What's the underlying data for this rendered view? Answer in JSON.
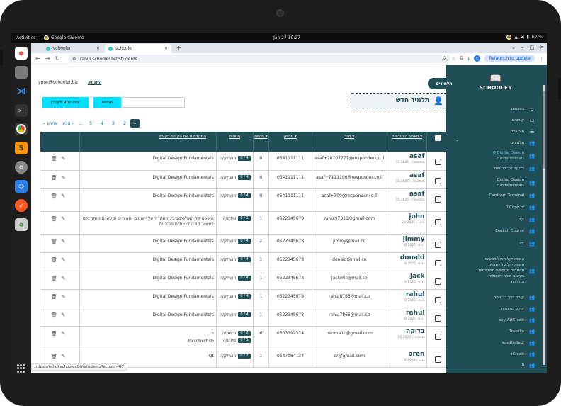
{
  "system": {
    "activities": "Activities",
    "app_name": "Google Chrome",
    "clock": "Jan 27  19:27",
    "battery": "62 %"
  },
  "browser": {
    "tabs": [
      {
        "label": "schooler"
      },
      {
        "label": "schooler"
      }
    ],
    "url": "rahul.schooler.biz/students",
    "relaunch": "Relaunch to update",
    "profile_initial": "E",
    "status_url": "https://rahul.schooler.biz/students?school=67"
  },
  "header": {
    "user_email": "ynon@schooler.biz",
    "logout": "התנתק",
    "students_tab": "תלמידים",
    "new_student": "תלמיד חדש",
    "search_button": "חיפוש",
    "export_button": "יצוא לקובץ csv",
    "search_placeholder": ""
  },
  "pager": {
    "items": [
      "« אחרון",
      "הבא ›",
      "...",
      "5",
      "4",
      "3",
      "2"
    ],
    "current": "1"
  },
  "sidebar": {
    "logo": "SCHOOLER",
    "items": [
      {
        "label": "בית ספר",
        "icon": "home-icon"
      },
      {
        "label": "קורסים",
        "icon": "monitor-icon"
      },
      {
        "label": "חיבורים",
        "icon": "sliders-icon"
      },
      {
        "label": "תלמידים",
        "icon": "users-icon"
      }
    ],
    "sub_items": [
      {
        "label": "0 Digital Design Fundamentals"
      },
      {
        "label": "בדיקה של רב טסר"
      },
      {
        "label": "Digital Design Fundamentals"
      },
      {
        "label": "Cardcom Terminal"
      },
      {
        "label": "0 Copy of"
      },
      {
        "label": "Qt"
      },
      {
        "label": "English Course"
      },
      {
        "label": "cc"
      },
      {
        "label": "האופטיקל האולטימטיבי: האופטיקל על יישומים ותאוריים ומעשיים מתקדמים בעיצוב מודה דיגיטלית מודרנית"
      },
      {
        "label": "קורס דרך רב טסר"
      },
      {
        "label": "קורס בחינמית"
      },
      {
        "label": "pay AUG edit"
      },
      {
        "label": "Tranzila"
      },
      {
        "label": "sgsdfsdfsdf"
      },
      {
        "label": "iCredit"
      },
      {
        "label": "0"
      }
    ]
  },
  "table": {
    "headers": {
      "name": "תאריך הצטרפות ▾",
      "mail": "מייל ▾",
      "phone": "טלפון ▾",
      "count": "מנויים ▾",
      "status": "סטטוס",
      "course": "התקדמות שם הקורס בקורס"
    },
    "rows": [
      {
        "name": "asaf",
        "date": "15 בספטמבר, 2025",
        "mail": "asaf+70707777@responder.co.il",
        "phone": "0541111111",
        "count": "0",
        "statuses": [
          {
            "label": "הועתק/ה",
            "badge": "0 / 4"
          }
        ],
        "course": "Digital Design Fundamentals"
      },
      {
        "name": "asaf",
        "date": "15 בספטמבר, 2025",
        "mail": "asaf+7111100@responder.co.il",
        "phone": "0541111111",
        "count": "0",
        "statuses": [
          {
            "label": "הועתק/ה",
            "badge": "0 / 4"
          }
        ],
        "course": "Digital Design Fundamentals"
      },
      {
        "name": "asaf",
        "date": "15 בספטמבר, 2025",
        "mail": "asaf+700@responder.co.il",
        "phone": "0541111111",
        "count": "0",
        "statuses": [
          {
            "label": "הועתק/ה",
            "badge": "0 / 4"
          }
        ],
        "course": "Digital Design Fundamentals"
      },
      {
        "name": "john",
        "date": "24 באוג׳, 2025",
        "mail": "rahul97811@gmail.com",
        "phone": "0522345678",
        "count": "1",
        "statuses": [
          {
            "label": "שילם/ה",
            "badge": "0 / 1"
          }
        ],
        "course": "האופטיקל האולטימטיבי: התקרף על יישומים ותאוריים ומעשיים מתקדמים בעיצוב מודה דיגיטלית מודרנית"
      },
      {
        "name": "jimmy",
        "date": "8 במאי, 2025",
        "mail": "jimmy@mail.co",
        "phone": "0522345678",
        "count": "2",
        "statuses": [
          {
            "label": "הועתק/ה",
            "badge": "0 / 4"
          }
        ],
        "course": "Digital Design Fundamentals"
      },
      {
        "name": "donald",
        "date": "8 במאי, 2025",
        "mail": "donald@mail.co",
        "phone": "0522345678",
        "count": "1",
        "statuses": [
          {
            "label": "הועתק/ה",
            "badge": "0 / 4"
          }
        ],
        "course": "Digital Design Fundamentals"
      },
      {
        "name": "jack",
        "date": "8 במאי, 2025",
        "mail": "jackmill@mail.co",
        "phone": "0522345678",
        "count": "1",
        "statuses": [
          {
            "label": "הועתק/ה",
            "badge": "0 / 4"
          }
        ],
        "course": "Digital Design Fundamentals"
      },
      {
        "name": "rahul",
        "date": "8 במאי, 2025",
        "mail": "rahul8765@mail.co",
        "phone": "0522345678",
        "count": "1",
        "statuses": [
          {
            "label": "הועתק/ה",
            "badge": "0 / 4"
          }
        ],
        "course": "Digital Design Fundamentals"
      },
      {
        "name": "rahul",
        "date": "8 במאי, 2025",
        "mail": "rahul7865@mail.co",
        "phone": "0522345678",
        "count": "1",
        "statuses": [
          {
            "label": "הועתק/ה",
            "badge": "0 / 4"
          }
        ],
        "course": "Digital Design Fundamentals"
      },
      {
        "name": "בדיקה",
        "date": "20 בנובמבר, 2024",
        "mail": "naoma1c@gmail.com",
        "phone": "0503392324",
        "count": "6",
        "statuses": [
          {
            "label": "נרשמ/ה",
            "badge": "0 / 2"
          },
          {
            "label": "שילם/ה",
            "badge": "0 / 1"
          }
        ],
        "course": "פ",
        "course2": "bxxcbxcbxb"
      },
      {
        "name": "oren",
        "date": "6 בנוב׳, 2024",
        "mail": "or@gmail.com",
        "phone": "0547984134",
        "count": "1",
        "statuses": [
          {
            "label": "הועתק/ה",
            "badge": "0 / 7"
          }
        ],
        "course": "Qt"
      }
    ]
  }
}
